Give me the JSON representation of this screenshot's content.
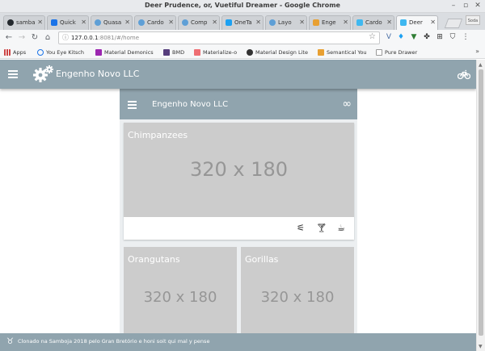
{
  "window": {
    "title": "Deer Prudence, or, Vuetiful Dreamer - Google Chrome"
  },
  "tabs": [
    {
      "label": "samba",
      "color": "#24292e"
    },
    {
      "label": "Quick",
      "color": "#1a73e8"
    },
    {
      "label": "Quasa",
      "color": "#5e9fd6"
    },
    {
      "label": "Cardo",
      "color": "#5e9fd6"
    },
    {
      "label": "Comp",
      "color": "#5e9fd6"
    },
    {
      "label": "OneTa",
      "color": "#1da1f2"
    },
    {
      "label": "Layo",
      "color": "#5e9fd6"
    },
    {
      "label": "Enge",
      "color": "#e8a032"
    },
    {
      "label": "Cardo",
      "color": "#3fb8f0"
    },
    {
      "label": "Deer",
      "color": "#3fb8f0"
    }
  ],
  "profile_label": "Soda",
  "address": {
    "host": "127.0.0.1",
    "rest": ":8081/#/home"
  },
  "bookmarks": [
    {
      "label": "Apps",
      "color": "#4a4a4a"
    },
    {
      "label": "You Eye Kitsch",
      "color": "#1a73e8"
    },
    {
      "label": "Material Demonics",
      "color": "#9c27b0"
    },
    {
      "label": "BMD",
      "color": "#563d7c"
    },
    {
      "label": "Materialize-o",
      "color": "#ee6e73"
    },
    {
      "label": "Material Design Lite",
      "color": "#333333"
    },
    {
      "label": "Semantical You",
      "color": "#e8a032"
    },
    {
      "label": "Pure Drawer",
      "color": "#888888"
    }
  ],
  "app": {
    "title": "Engenho Novo LLC"
  },
  "panel": {
    "title": "Engenho Novo LLC"
  },
  "cards": [
    {
      "caption": "Chimpanzees",
      "placeholder": "320 x 180"
    },
    {
      "caption": "Orangutans",
      "placeholder": "320 x 180"
    },
    {
      "caption": "Gorillas",
      "placeholder": "320 x 180"
    }
  ],
  "footer": {
    "text": "Clonado na Samboja 2018 pelo Gran Bretório e honi soit qui mal y pense"
  },
  "colors": {
    "primary": "#90a4ae",
    "placeholder_bg": "#cccccc",
    "placeholder_text": "#969696"
  }
}
